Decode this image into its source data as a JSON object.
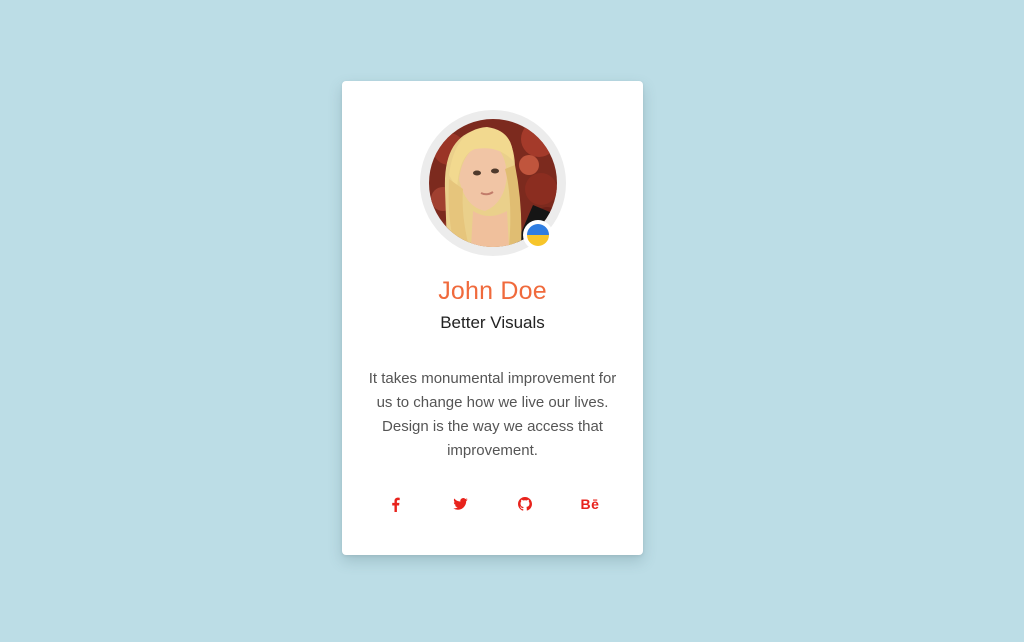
{
  "profile": {
    "name": "John Doe",
    "subtitle": "Better Visuals",
    "description": "It takes monumental improvement for us to change how we live our lives. Design is the way we access that improvement."
  },
  "badge": {
    "icon": "ukraine-flag-icon",
    "colors": [
      "#2f7de1",
      "#f7c52a"
    ]
  },
  "social": [
    {
      "icon": "facebook-icon",
      "glyph": "f"
    },
    {
      "icon": "twitter-icon"
    },
    {
      "icon": "github-icon"
    },
    {
      "icon": "behance-icon",
      "glyph": "Bē"
    }
  ],
  "colors": {
    "background": "#bcdde6",
    "card": "#ffffff",
    "name": "#f06a3c",
    "social": "#e8231c"
  }
}
